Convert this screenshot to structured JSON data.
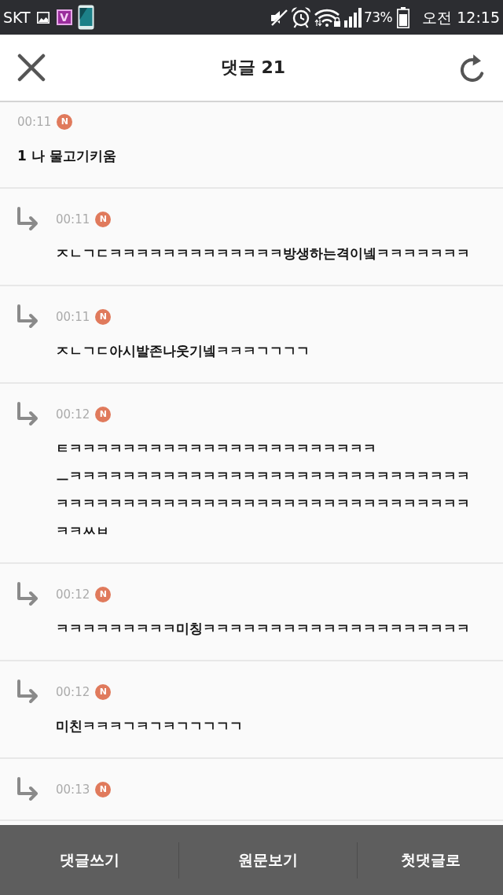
{
  "status_bar": {
    "carrier": "SKT",
    "app_icon_letter": "V",
    "battery_percent": "73%",
    "time": "오전 12:15"
  },
  "header": {
    "title": "댓글 21"
  },
  "comments": [
    {
      "kind": "comment",
      "time": "00:11",
      "badge": "N",
      "paragraphs": [
        "1 나 물고기키움"
      ]
    },
    {
      "kind": "reply",
      "time": "00:11",
      "badge": "N",
      "paragraphs": [
        "ㅈㄴㄱㄷㅋㅋㅋㅋㅋㅋㅋㅋㅋㅋㅋㅋㅋ방생하는격이넼ㅋㅋㅋㅋㅋㅋㅋ"
      ]
    },
    {
      "kind": "reply",
      "time": "00:11",
      "badge": "N",
      "paragraphs": [
        "ㅈㄴㄱㄷ아시발존나웃기넼ㅋㅋㅋㄱㄱㄱㄱ"
      ]
    },
    {
      "kind": "reply",
      "time": "00:12",
      "badge": "N",
      "paragraphs": [
        "ㅌㅋㅋㅋㅋㅋㅋㅋㅋㅋㅋㅋㅋㅋㅋㅋㅋㅋㅋㅋㅋㅋㅋㅋ",
        "ㅡㅋㅋㅋㅋㅋㅋㅋㅋㅋㅋㅋㅋㅋㅋㅋㅋㅋㅋㅋㅋㅋㅋㅋㅋㅋㅋㅋㅋㅋㅋㅋㅋㅋㅋㅋㅋㅋㅋㅋㅋㅋㅋㅋㅋㅋㅋㅋㅋㅋㅋㅋㅋㅋㅋㅋㅋㅋㅋㅋㅋㅋㅋㅋㅆㅂ"
      ]
    },
    {
      "kind": "reply",
      "time": "00:12",
      "badge": "N",
      "paragraphs": [
        "ㅋㅋㅋㅋㅋㅋㅋㅋㅋ미칭ㅋㅋㅋㅋㅋㅋㅋㅋㅋㅋㅋㅋㅋㅋㅋㅋㅋㅋㅋㅋ"
      ]
    },
    {
      "kind": "reply",
      "time": "00:12",
      "badge": "N",
      "paragraphs": [
        "미친ㅋㅋㅋㄱㅋㄱㅋㄱㄱㄱㄱㄱ"
      ]
    },
    {
      "kind": "reply",
      "time": "00:13",
      "badge": "N"
    }
  ],
  "bottom_bar": {
    "buttons": [
      "댓글쓰기",
      "원문보기",
      "첫댓글로"
    ]
  }
}
